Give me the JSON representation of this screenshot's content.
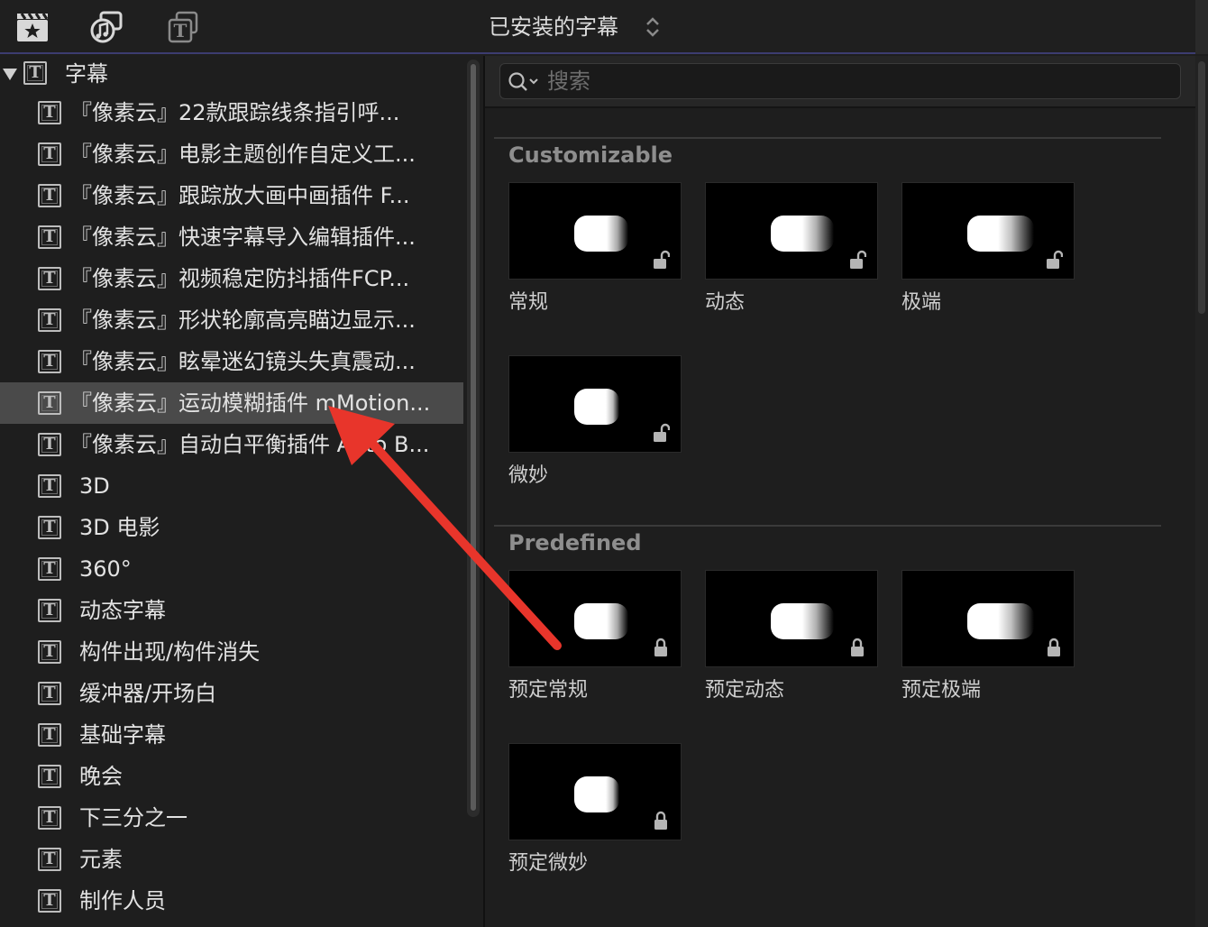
{
  "toolbar": {
    "icons": [
      "clapper-star-icon",
      "music-photo-icon",
      "titles-icon"
    ],
    "title": "已安装的字幕"
  },
  "sidebar": {
    "root": {
      "icon": "title-t-icon",
      "label": "字幕"
    },
    "items": [
      {
        "label": "『像素云』22款跟踪线条指引呼...",
        "selected": false
      },
      {
        "label": "『像素云』电影主题创作自定义工...",
        "selected": false
      },
      {
        "label": "『像素云』跟踪放大画中画插件 F...",
        "selected": false
      },
      {
        "label": "『像素云』快速字幕导入编辑插件...",
        "selected": false
      },
      {
        "label": "『像素云』视频稳定防抖插件FCP...",
        "selected": false
      },
      {
        "label": "『像素云』形状轮廓高亮瞄边显示...",
        "selected": false
      },
      {
        "label": "『像素云』眩晕迷幻镜头失真震动...",
        "selected": false
      },
      {
        "label": "『像素云』运动模糊插件 mMotion...",
        "selected": true
      },
      {
        "label": "『像素云』自动白平衡插件 Auto B...",
        "selected": false
      },
      {
        "label": "3D",
        "selected": false
      },
      {
        "label": "3D 电影",
        "selected": false
      },
      {
        "label": "360°",
        "selected": false
      },
      {
        "label": "动态字幕",
        "selected": false
      },
      {
        "label": "构件出现/构件消失",
        "selected": false
      },
      {
        "label": "缓冲器/开场白",
        "selected": false
      },
      {
        "label": "基础字幕",
        "selected": false
      },
      {
        "label": "晚会",
        "selected": false
      },
      {
        "label": "下三分之一",
        "selected": false
      },
      {
        "label": "元素",
        "selected": false
      },
      {
        "label": "制作人员",
        "selected": false
      }
    ]
  },
  "search": {
    "placeholder": "搜索",
    "value": ""
  },
  "sections": [
    {
      "title": "Customizable",
      "tiles": [
        {
          "label": "常规",
          "lock": "unlocked-icon"
        },
        {
          "label": "动态",
          "lock": "unlocked-icon"
        },
        {
          "label": "极端",
          "lock": "unlocked-icon"
        },
        {
          "label": "微妙",
          "lock": "unlocked-icon"
        }
      ]
    },
    {
      "title": "Predefined",
      "tiles": [
        {
          "label": "预定常规",
          "lock": "locked-icon"
        },
        {
          "label": "预定动态",
          "lock": "locked-icon"
        },
        {
          "label": "预定极端",
          "lock": "locked-icon"
        },
        {
          "label": "预定微妙",
          "lock": "locked-icon"
        }
      ]
    }
  ],
  "colors": {
    "background": "#1e1e1e",
    "selection": "#4a4a4a",
    "accent_line": "#3c3c70",
    "annotation_arrow": "#e8352b"
  }
}
